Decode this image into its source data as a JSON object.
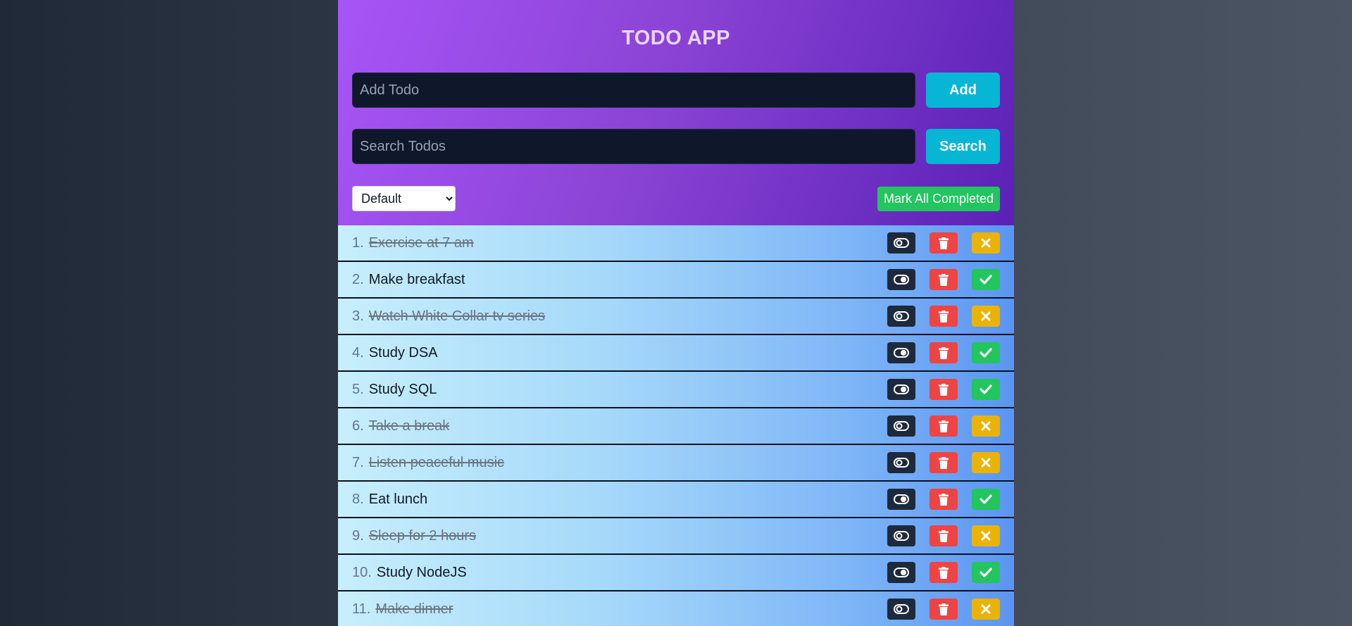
{
  "header": {
    "title": "TODO APP"
  },
  "add": {
    "placeholder": "Add Todo",
    "button_label": "Add"
  },
  "search": {
    "placeholder": "Search Todos",
    "button_label": "Search"
  },
  "sort": {
    "selected": "Default"
  },
  "mark_all_label": "Mark All Completed",
  "colors": {
    "accent": "#06b6d4",
    "header_gradient_start": "#a855f7",
    "header_gradient_end": "#5b21b6",
    "complete_green": "#22c55e",
    "delete_red": "#ef4444",
    "pending_yellow": "#eab308",
    "toggle_dark": "#1e293b"
  },
  "icons": {
    "toggle": "toggle-icon",
    "delete": "trash-icon",
    "complete": "check-icon",
    "incomplete": "x-icon"
  },
  "todos": [
    {
      "num": "1.",
      "text": "Exercise at 7 am",
      "completed": true
    },
    {
      "num": "2.",
      "text": "Make breakfast",
      "completed": false
    },
    {
      "num": "3.",
      "text": "Watch White Collar tv series",
      "completed": true
    },
    {
      "num": "4.",
      "text": "Study DSA",
      "completed": false
    },
    {
      "num": "5.",
      "text": "Study SQL",
      "completed": false
    },
    {
      "num": "6.",
      "text": "Take a break",
      "completed": true
    },
    {
      "num": "7.",
      "text": "Listen peaceful music",
      "completed": true
    },
    {
      "num": "8.",
      "text": "Eat lunch",
      "completed": false
    },
    {
      "num": "9.",
      "text": "Sleep for 2 hours",
      "completed": true
    },
    {
      "num": "10.",
      "text": "Study NodeJS",
      "completed": false
    },
    {
      "num": "11.",
      "text": "Make dinner",
      "completed": true
    }
  ]
}
